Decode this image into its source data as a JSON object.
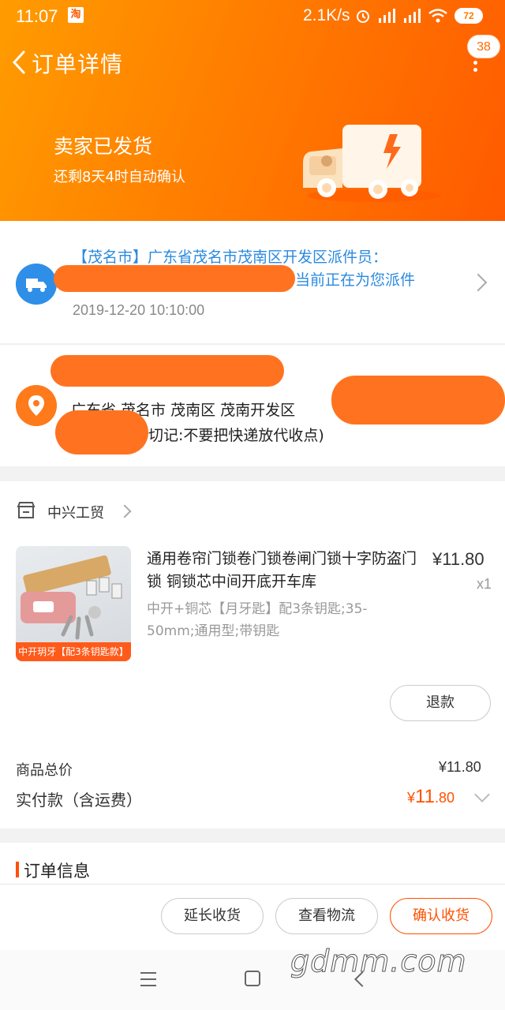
{
  "status_bar": {
    "time": "11:07",
    "app_badge": "淘",
    "speed": "2.1K/s",
    "battery": "72"
  },
  "nav": {
    "title": "订单详情",
    "badge": "38"
  },
  "shipment": {
    "status": "卖家已发货",
    "auto_confirm": "还剩8天4时自动确认"
  },
  "logistics": {
    "line1": "【茂名市】广东省茂名市茂南区开发区派件员：",
    "line2_tail": "当前正在为您派件",
    "time": "2019-12-20 10:10:00"
  },
  "address": {
    "line1": "广东省 茂名市 茂南区 茂南开发区",
    "line2": "切记:不要把快递放代收点)"
  },
  "shop": {
    "name": "中兴工贸"
  },
  "product": {
    "title": "通用卷帘门锁卷门锁卷闸门锁十字防盗门锁 铜锁芯中间开底开车库",
    "price": "¥11.80",
    "qty": "x1",
    "spec": "中开+铜芯【月牙匙】配3条钥匙;35-50mm;通用型;带钥匙",
    "image_tag": "中开玥牙【配3条钥匙款】"
  },
  "buttons": {
    "refund": "退款",
    "extend": "延长收货",
    "view_logistics": "查看物流",
    "confirm": "确认收货"
  },
  "totals": {
    "goods_label": "商品总价",
    "goods_value": "¥11.80",
    "paid_label": "实付款（含运费）",
    "paid_currency": "¥",
    "paid_int": "11",
    "paid_dec": ".80"
  },
  "order_info": {
    "title": "订单信息"
  },
  "watermark": "gdmm.com",
  "colors": {
    "header_start": "#ff9c00",
    "header_end": "#ff5a00",
    "accent": "#ff5000",
    "link_blue": "#2a8ae0"
  }
}
